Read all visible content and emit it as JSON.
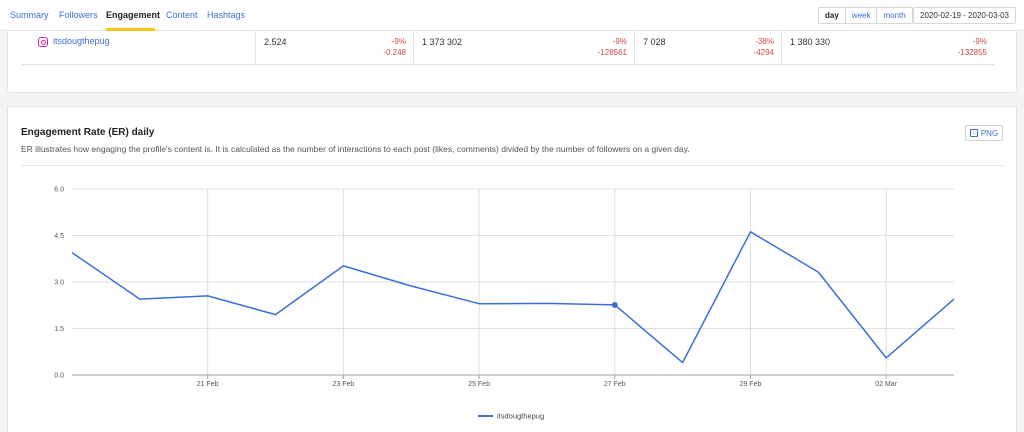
{
  "tabs": [
    {
      "label": "Summary",
      "active": false
    },
    {
      "label": "Followers",
      "active": false
    },
    {
      "label": "Engagement",
      "active": true
    },
    {
      "label": "Content",
      "active": false
    },
    {
      "label": "Hashtags",
      "active": false
    }
  ],
  "accent_color": "#f5c518",
  "link_color": "#3b6fd6",
  "period": {
    "day": "day",
    "week": "week",
    "month": "month",
    "selected": "day"
  },
  "date_range": "2020-02-19 - 2020-03-03",
  "table_row": {
    "profile_name": "itsdougthepug",
    "profile_icon": "instagram-icon",
    "cells": [
      {
        "value": "2.524",
        "pct": "-9%",
        "delta": "-0.248"
      },
      {
        "value": "1 373 302",
        "pct": "-9%",
        "delta": "-128561"
      },
      {
        "value": "7 028",
        "pct": "-38%",
        "delta": "-4294"
      },
      {
        "value": "1 380 330",
        "pct": "-9%",
        "delta": "-132855"
      }
    ],
    "negative_color": "#d04848"
  },
  "er_card": {
    "title": "Engagement Rate (ER) daily",
    "description": "ER illustrates how engaging the profile's content is. It is calculated as the number of interactions to each post (likes, comments) divided by the number of followers on a given day.",
    "png_button": "PNG",
    "png_icon": "download-icon"
  },
  "chart_data": {
    "type": "line",
    "x": [
      "2020-02-19",
      "2020-02-20",
      "2020-02-21",
      "2020-02-22",
      "2020-02-23",
      "2020-02-24",
      "2020-02-25",
      "2020-02-26",
      "2020-02-27",
      "2020-02-28",
      "2020-02-29",
      "2020-03-01",
      "2020-03-02",
      "2020-03-03"
    ],
    "x_tick_labels": [
      {
        "x": "2020-02-21",
        "label": "21 Feb"
      },
      {
        "x": "2020-02-23",
        "label": "23 Feb"
      },
      {
        "x": "2020-02-25",
        "label": "25 Feb"
      },
      {
        "x": "2020-02-27",
        "label": "27 Feb"
      },
      {
        "x": "2020-02-29",
        "label": "29 Feb"
      },
      {
        "x": "2020-03-02",
        "label": "02 Mar"
      }
    ],
    "series": [
      {
        "name": "itsdougthepug",
        "color": "#3a6fd8",
        "values": [
          3.95,
          2.45,
          2.55,
          1.95,
          3.52,
          2.87,
          2.3,
          2.31,
          2.26,
          0.4,
          4.62,
          3.32,
          0.55,
          2.45
        ]
      }
    ],
    "y_ticks": [
      "0.0",
      "1.5",
      "3.0",
      "4.5",
      "6.0"
    ],
    "ylim": [
      0,
      6
    ],
    "highlighted_point": "2020-02-27",
    "grid": true,
    "legend": "bottom-center"
  }
}
